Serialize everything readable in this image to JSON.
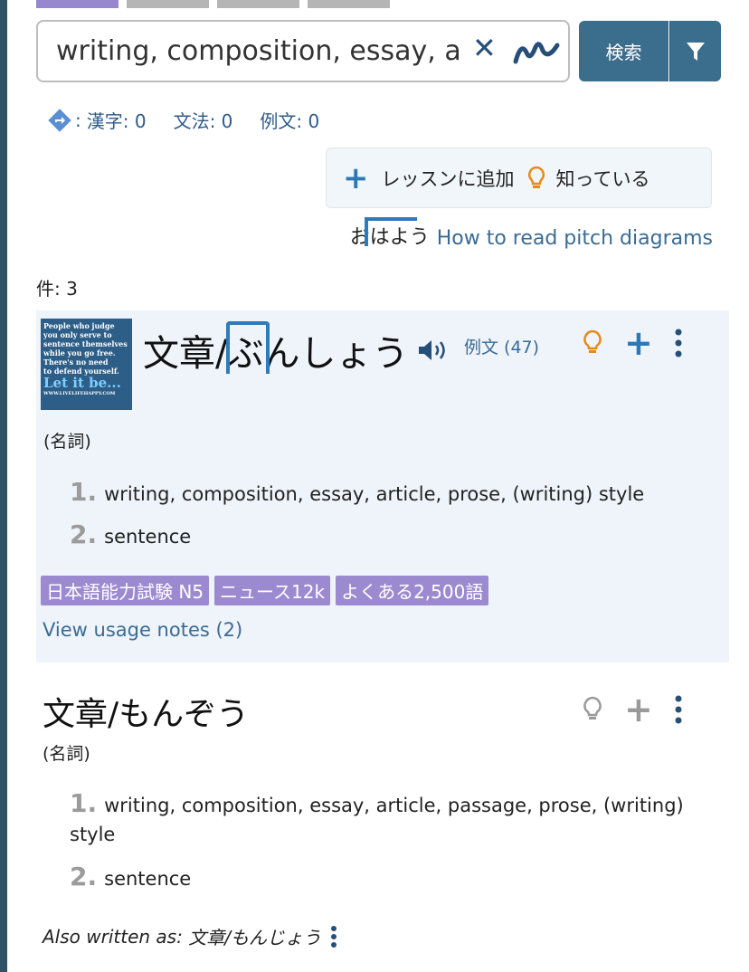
{
  "search": {
    "value": "writing, composition, essay, a",
    "search_label": "検索"
  },
  "counts": {
    "kanji": "漢字: 0",
    "grammar": "文法: 0",
    "sentences": "例文: 0",
    "prefix": ":"
  },
  "actions": {
    "add_lesson": "レッスンに追加",
    "known": "知っている"
  },
  "pitch_help": {
    "sample": "おはよう",
    "link": "How to read pitch diagrams"
  },
  "result_count": "件: 3",
  "entry1": {
    "thumb_lines": [
      "People who judge",
      "you only serve to",
      "sentence themselves",
      "while you go free.",
      "There's no need",
      "to defend yourself.",
      "Let it be...",
      "WWW.LIVELIFEHAPPY.COM"
    ],
    "word": "文章/ぶんしょう",
    "examples": "例文 (47)",
    "pos": "(名詞)",
    "senses": [
      {
        "num": "1.",
        "text": "writing, composition, essay, article, prose, (writing) style"
      },
      {
        "num": "2.",
        "text": "sentence"
      }
    ],
    "tags": [
      "日本語能力試験 N5",
      "ニュース12k",
      "よくある2,500語"
    ],
    "usage": "View usage notes (2)"
  },
  "entry2": {
    "word": "文章/もんぞう",
    "pos": "(名詞)",
    "senses": [
      {
        "num": "1.",
        "text": "writing, composition, essay, article, passage, prose, (writing) style"
      },
      {
        "num": "2.",
        "text": "sentence"
      }
    ],
    "also_label": "Also written as",
    "also_value": "文章/もんじょう"
  },
  "colors": {
    "accent": "#3b6d8d",
    "link": "#3a6b94",
    "tag": "#9c8ad0",
    "bulb": "#e88a1a"
  }
}
